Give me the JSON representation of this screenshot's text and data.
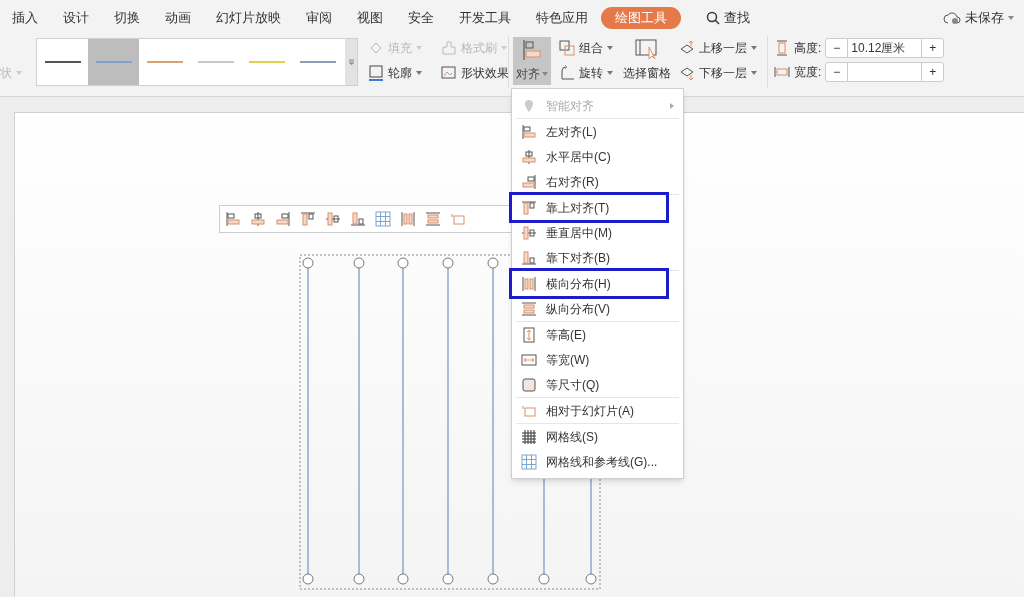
{
  "tabs": [
    {
      "label": "插入",
      "selected": false
    },
    {
      "label": "设计",
      "selected": false
    },
    {
      "label": "切换",
      "selected": false
    },
    {
      "label": "动画",
      "selected": false
    },
    {
      "label": "幻灯片放映",
      "selected": false
    },
    {
      "label": "审阅",
      "selected": false
    },
    {
      "label": "视图",
      "selected": false
    },
    {
      "label": "安全",
      "selected": false
    },
    {
      "label": "开发工具",
      "selected": false
    },
    {
      "label": "特色应用",
      "selected": false
    },
    {
      "label": "绘图工具",
      "selected": true
    }
  ],
  "search": {
    "label": "查找"
  },
  "save_status": {
    "label": "未保存"
  },
  "ribbon": {
    "cut_button": {
      "label": "状",
      "disabled": true
    },
    "line_styles": [
      {
        "color": "#555555",
        "selected": false
      },
      {
        "color": "#7fa3cc",
        "selected": true
      },
      {
        "color": "#d9a070",
        "selected": false
      },
      {
        "color": "#c8c8c8",
        "selected": false
      },
      {
        "color": "#e0d050",
        "selected": false
      },
      {
        "color": "#8aa0b8",
        "selected": false
      }
    ],
    "format_buttons": [
      {
        "label": "填充",
        "disabled": true
      },
      {
        "label": "格式刷",
        "disabled": true
      },
      {
        "label": "轮廓",
        "disabled": false
      },
      {
        "label": "形状效果",
        "disabled": false
      }
    ],
    "align_button": {
      "label": "对齐",
      "selected": true
    },
    "arrange_buttons": [
      {
        "label": "组合"
      },
      {
        "label": "旋转"
      }
    ],
    "selection_pane": {
      "label": "选择窗格"
    },
    "layer_buttons": [
      {
        "label": "上移一层"
      },
      {
        "label": "下移一层"
      }
    ],
    "size_fields": [
      {
        "label": "高度:",
        "value": "10.12厘米",
        "minus": "−",
        "plus": "+"
      },
      {
        "label": "宽度:",
        "minus": "−",
        "plus": "+"
      }
    ]
  },
  "align_menu": {
    "groups": [
      [
        {
          "label": "智能对齐",
          "disabled": true,
          "highlighted": false,
          "submenu": true
        }
      ],
      [
        {
          "label": "左对齐(L)",
          "disabled": false,
          "highlighted": false
        },
        {
          "label": "水平居中(C)",
          "disabled": false,
          "highlighted": false
        },
        {
          "label": "右对齐(R)",
          "disabled": false,
          "highlighted": false
        }
      ],
      [
        {
          "label": "靠上对齐(T)",
          "disabled": false,
          "highlighted": true
        },
        {
          "label": "垂直居中(M)",
          "disabled": false,
          "highlighted": false
        },
        {
          "label": "靠下对齐(B)",
          "disabled": false,
          "highlighted": false
        }
      ],
      [
        {
          "label": "横向分布(H)",
          "disabled": false,
          "highlighted": true
        },
        {
          "label": "纵向分布(V)",
          "disabled": false,
          "highlighted": false
        }
      ],
      [
        {
          "label": "等高(E)",
          "disabled": false,
          "highlighted": false
        },
        {
          "label": "等宽(W)",
          "disabled": false,
          "highlighted": false
        },
        {
          "label": "等尺寸(Q)",
          "disabled": false,
          "highlighted": false
        }
      ],
      [
        {
          "label": "相对于幻灯片(A)",
          "disabled": false,
          "highlighted": false
        }
      ],
      [
        {
          "label": "网格线(S)",
          "disabled": false,
          "highlighted": false
        },
        {
          "label": "网格线和参考线(G)...",
          "disabled": false,
          "highlighted": false
        }
      ]
    ]
  }
}
